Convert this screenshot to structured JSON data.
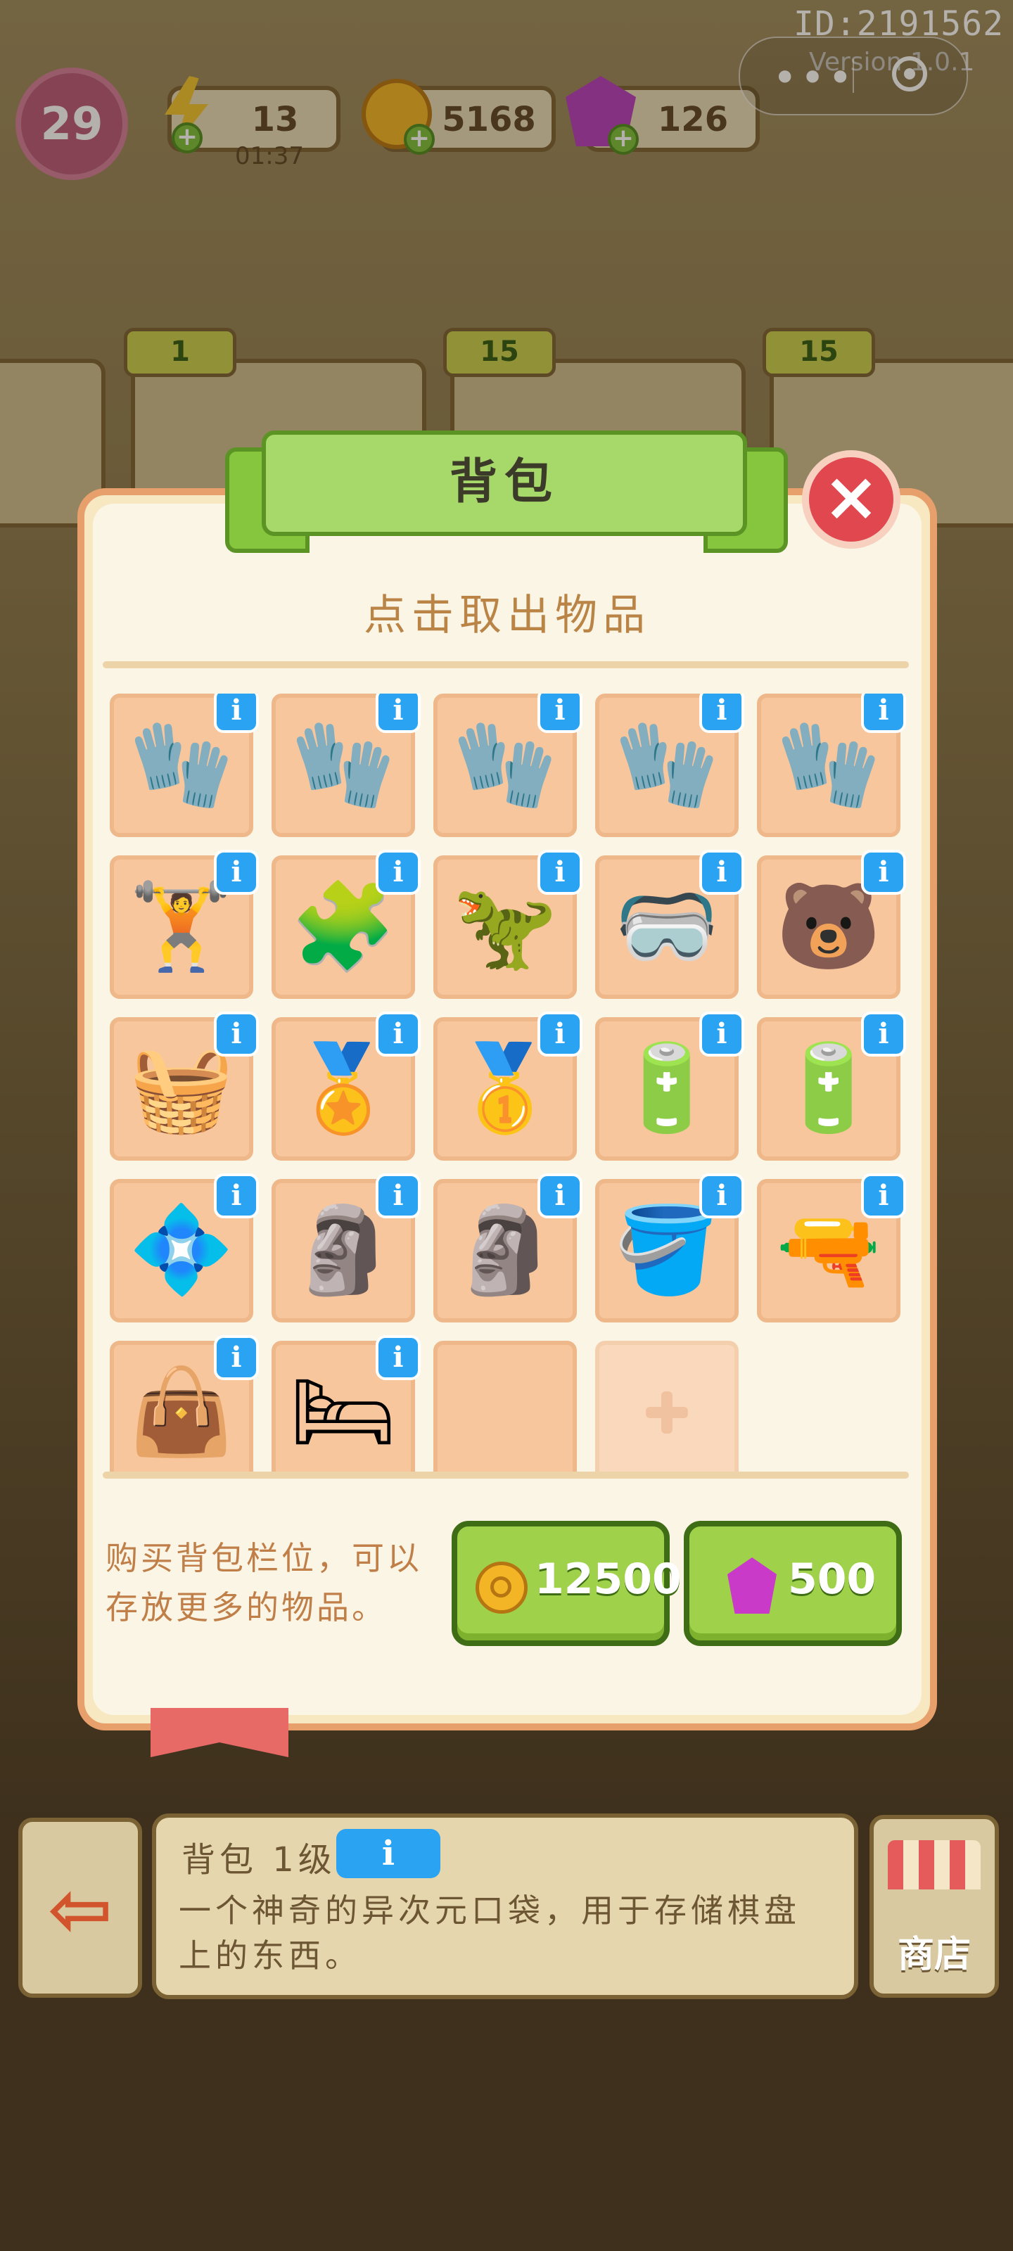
{
  "hud": {
    "player_id": "ID:2191562",
    "version": "Version 1.0.1",
    "level": "29",
    "energy": {
      "value": "13",
      "timer": "01:37"
    },
    "coins": "5168",
    "gems": "126"
  },
  "shelves": [
    {
      "stars": "1"
    },
    {
      "stars": "15"
    },
    {
      "stars": "15"
    }
  ],
  "dialog": {
    "title": "背包",
    "subtitle": "点击取出物品",
    "close_icon": "close-icon",
    "items": [
      {
        "icon": "gloves-icon",
        "glyph": "🧤"
      },
      {
        "icon": "gloves-icon",
        "glyph": "🧤"
      },
      {
        "icon": "gloves-icon",
        "glyph": "🧤"
      },
      {
        "icon": "gloves-icon",
        "glyph": "🧤"
      },
      {
        "icon": "gloves-icon",
        "glyph": "🧤"
      },
      {
        "icon": "bench-press-icon",
        "glyph": "🏋"
      },
      {
        "icon": "puzzle-pieces-icon",
        "glyph": "🧩"
      },
      {
        "icon": "dinosaur-backpack-icon",
        "glyph": "🦖"
      },
      {
        "icon": "vr-headset-icon",
        "glyph": "🥽"
      },
      {
        "icon": "bear-badge-icon",
        "glyph": "🐻"
      },
      {
        "icon": "basket-icon",
        "glyph": "🧺"
      },
      {
        "icon": "gold-medal-icon",
        "glyph": "🏅"
      },
      {
        "icon": "first-place-medal-icon",
        "glyph": "🥇"
      },
      {
        "icon": "capacitor-icon",
        "glyph": "🔋"
      },
      {
        "icon": "capacitors-icon",
        "glyph": "🔋"
      },
      {
        "icon": "circuit-board-icon",
        "glyph": "💠"
      },
      {
        "icon": "statue-spear-icon",
        "glyph": "🗿"
      },
      {
        "icon": "statue-sword-icon",
        "glyph": "🗿"
      },
      {
        "icon": "sand-bucket-icon",
        "glyph": "🪣"
      },
      {
        "icon": "water-gun-icon",
        "glyph": "🔫"
      },
      {
        "icon": "pink-bag-icon",
        "glyph": "👜"
      },
      {
        "icon": "pillow-icon",
        "glyph": "🛏"
      }
    ],
    "buy_text": "购买背包栏位，可以存放更多的物品。",
    "buy_coins": "12500",
    "buy_gems": "500"
  },
  "bottom": {
    "item_title": "背包 1级",
    "info_label": "i",
    "item_desc": "一个神奇的异次元口袋，用于存储棋盘上的东西。",
    "shop_label": "商店"
  },
  "colors": {
    "panel_border": "#e7a06b",
    "slot_bg": "#f8c69d",
    "button_green": "#9fd24a",
    "info_blue": "#2aa3f2",
    "close_red": "#e0474f"
  }
}
